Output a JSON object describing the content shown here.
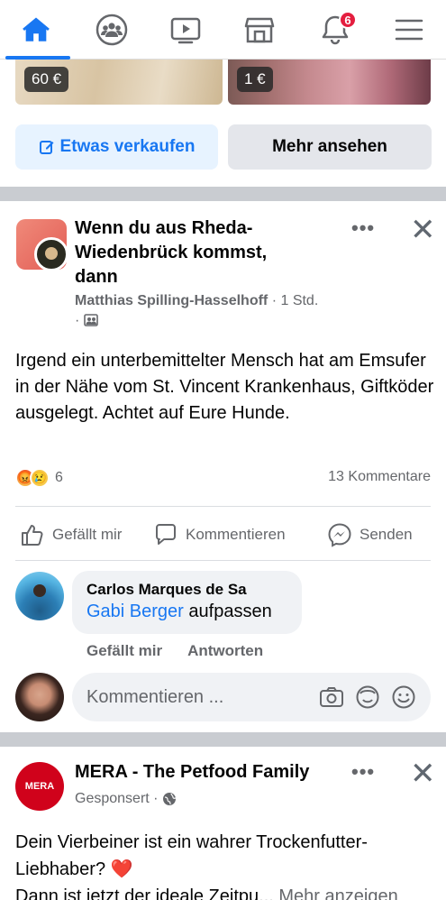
{
  "nav": {
    "items": [
      {
        "name": "home",
        "icon": "home-icon",
        "active": true
      },
      {
        "name": "groups",
        "icon": "groups-icon"
      },
      {
        "name": "watch",
        "icon": "video-icon"
      },
      {
        "name": "marketplace",
        "icon": "store-icon"
      },
      {
        "name": "notifications",
        "icon": "bell-icon"
      },
      {
        "name": "menu",
        "icon": "menu-icon"
      }
    ],
    "notification_count": "6",
    "accent": "#1877f2"
  },
  "marketplace": {
    "prices": [
      "60 €",
      "1 €"
    ],
    "sell_button": "Etwas verkaufen",
    "more_button": "Mehr ansehen"
  },
  "post": {
    "title": "Wenn du aus Rheda-Wiedenbrück kommst, dann",
    "author": "Matthias Spilling-Hasselhoff",
    "time": " · 1 Std. · ",
    "text": "Irgend ein unterbemittelter Mensch hat am Emsufer in der Nähe vom St. Vincent Krankenhaus, Giftköder ausgelegt. Achtet auf Eure Hunde.",
    "reaction_count": "6",
    "comment_count": "13 Kommentare",
    "actions": {
      "like": "Gefällt mir",
      "comment": "Kommentieren",
      "send": "Senden"
    }
  },
  "comment": {
    "author": "Carlos Marques de Sa",
    "mention": "Gabi Berger",
    "text": " aufpassen",
    "like": "Gefällt mir",
    "reply": "Antworten"
  },
  "composer": {
    "placeholder": "Kommentieren ..."
  },
  "ad": {
    "logo_text": "MERA",
    "title": "MERA - The Petfood Family",
    "sponsored": "Gesponsert ·",
    "text": "Dein Vierbeiner ist ein wahrer Trockenfutter-Liebhaber? ",
    "text2": "Dann ist jetzt der ideale Zeitpu",
    "more": "... Mehr anzeigen"
  }
}
